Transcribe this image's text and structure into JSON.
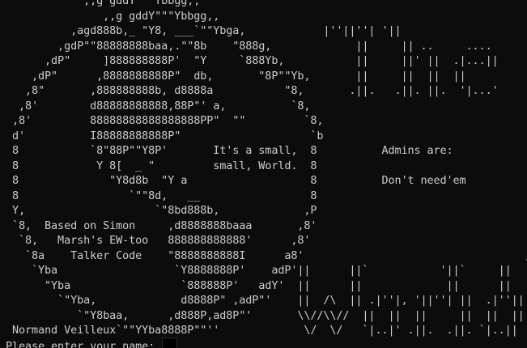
{
  "terminal": {
    "banner_lines": [
      "            ,,g gddY\"\"\"Ybbgg,,",
      "               ,,g gddY\"\"\"Ybbgg,,",
      "          ,agd888b,_ \"Y8, ___`\"\"Ybga,            |''||''| '||",
      "        ,gdP\"\"88888888baa,.\"\"8b    \"888g,             ||     || ..     ....",
      "      ,dP\"     ]888888888P'  \"Y     `888Yb,           ||     ||' ||  .|...||",
      "    ,dP\"      ,8888888888P\"  db,       \"8P\"\"Yb,       ||     ||  ||  ||",
      "   ,8\"       ,888888888b, d8888a           \"8,       .||.   .||. ||.  '|...'",
      "  ,8'        d88888888888,88P\"' a,          `8,",
      " ,8'         88888888888888888PP\"  \"\"         `8,",
      " d'          I88888888888P\"                    `b",
      " 8           `8\"88P\"\"Y8P'       It's a small,  8          Admins are:",
      " 8            Y 8[  _ \"         small, World.  8",
      " 8              \"Y8d8b  \"Y a                   8          Don't need'em",
      " 8                 `\"\"8d,   __                 8",
      " Y,                    `\"8bd888b,             ,P",
      " `8,  Based on Simon     ,d8888888baaa       ,8'",
      "  `8,   Marsh's EW-too   888888888888'      ,8'",
      "   `8a    Talker Code    \"8888888888I      a8'                                  ,",
      "    `Yba                  `Y8888888P'    adP'||      ||`           '||`     ||",
      "      \"Yba                 `888888P'   adY'  ||      ||             ||      ||",
      "        `\"Yba,             d8888P\" ,adP\"'    ||  /\\  || .|''|, '||''| ||  .|''||",
      "           `\"Y8baa,      ,d888P,ad8P\"'       \\\\//\\\\//  ||  ||  ||     ||  ||  ||",
      " Normand Veilleux`\"\"YYba8888P\"\"''             \\/  \\/   `|..|' .||.  .||. `|..||"
    ],
    "prompt_text": "Please enter your name:",
    "input_value": ""
  }
}
